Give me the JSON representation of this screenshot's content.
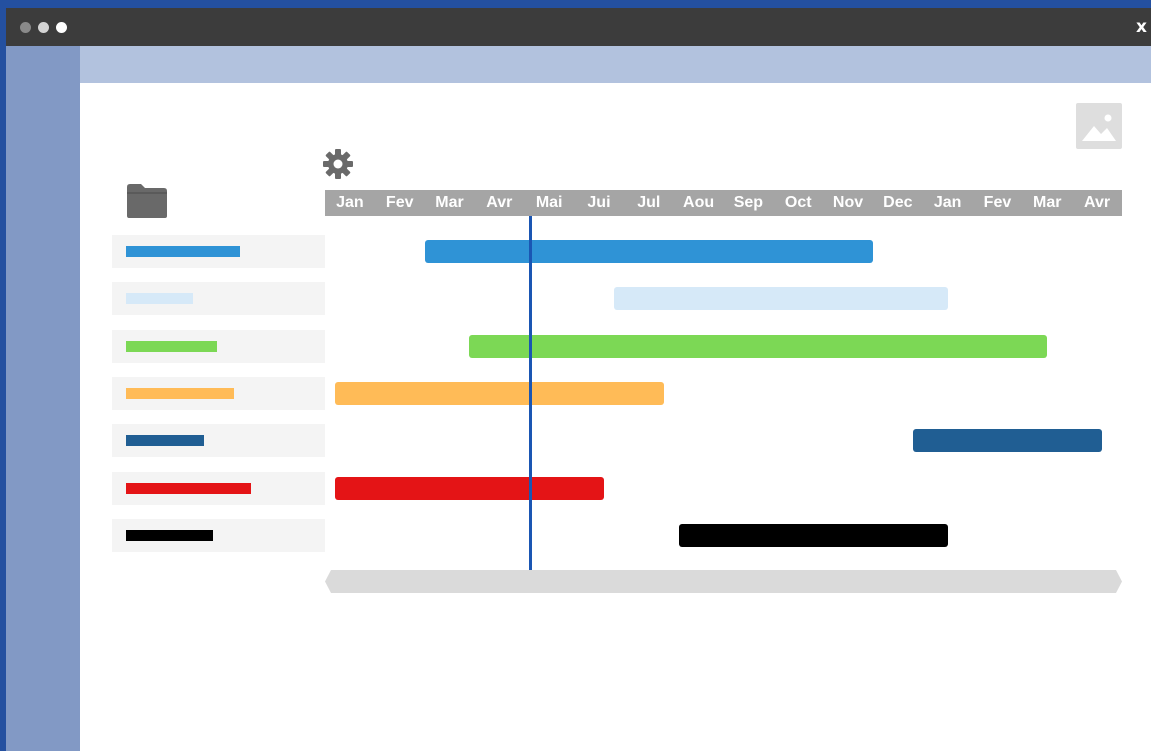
{
  "window": {
    "close_label": "x"
  },
  "timeline": {
    "months": [
      "Jan",
      "Fev",
      "Mar",
      "Avr",
      "Mai",
      "Jui",
      "Jul",
      "Aou",
      "Sep",
      "Oct",
      "Nov",
      "Dec",
      "Jan",
      "Fev",
      "Mar",
      "Avr"
    ]
  },
  "icons": {
    "settings": "gear-icon",
    "folder": "folder-icon",
    "image": "image-placeholder-icon"
  },
  "tasks": [
    {
      "color": "#2f93d6",
      "start_month": 2.0,
      "end_month": 11.0,
      "legend_fill": 0.6
    },
    {
      "color": "#d6e9f8",
      "start_month": 5.8,
      "end_month": 12.5,
      "legend_fill": 0.35
    },
    {
      "color": "#7cd855",
      "start_month": 2.9,
      "end_month": 14.5,
      "legend_fill": 0.48
    },
    {
      "color": "#ffbb57",
      "start_month": 0.2,
      "end_month": 6.8,
      "legend_fill": 0.57
    },
    {
      "color": "#205e93",
      "start_month": 11.8,
      "end_month": 15.6,
      "legend_fill": 0.41
    },
    {
      "color": "#e41416",
      "start_month": 0.2,
      "end_month": 5.6,
      "legend_fill": 0.66
    },
    {
      "color": "#000000",
      "start_month": 7.1,
      "end_month": 12.5,
      "legend_fill": 0.46
    }
  ],
  "today_month": 4.1
}
